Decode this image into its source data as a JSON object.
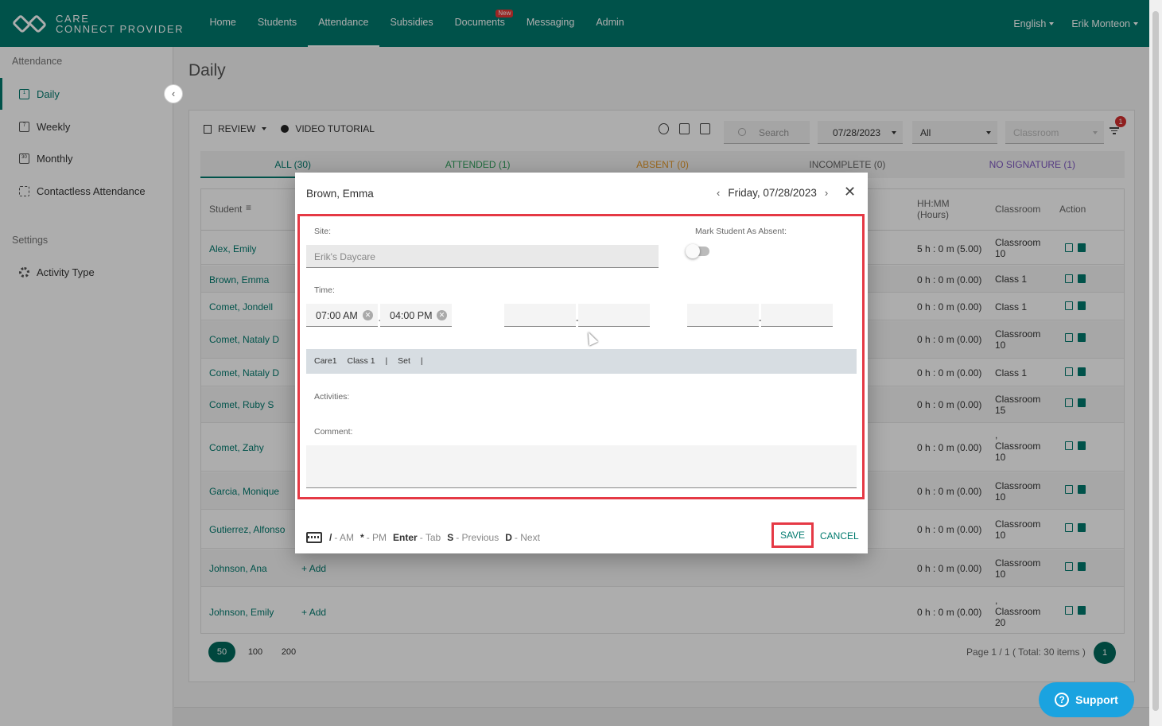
{
  "brand": {
    "line1": "CARE",
    "line2": "CONNECT PROVIDER"
  },
  "nav": {
    "items": [
      {
        "label": "Home"
      },
      {
        "label": "Students"
      },
      {
        "label": "Attendance"
      },
      {
        "label": "Subsidies"
      },
      {
        "label": "Documents"
      },
      {
        "label": "Messaging"
      },
      {
        "label": "Admin"
      }
    ],
    "new_badge": "New",
    "language": "English",
    "user": "Erik Monteon"
  },
  "sidebar": {
    "heading1": "Attendance",
    "items": [
      {
        "label": "Daily",
        "icon": "calendar-day-icon",
        "glyph": "1"
      },
      {
        "label": "Weekly",
        "icon": "calendar-week-icon",
        "glyph": "7"
      },
      {
        "label": "Monthly",
        "icon": "calendar-month-icon",
        "glyph": "30"
      },
      {
        "label": "Contactless Attendance",
        "icon": "grid-icon",
        "glyph": ""
      }
    ],
    "heading2": "Settings",
    "settings_item": {
      "label": "Activity Type",
      "icon": "gear-icon"
    },
    "collapse_glyph": "‹"
  },
  "page": {
    "title": "Daily"
  },
  "toolbar": {
    "review": "REVIEW",
    "video": "VIDEO TUTORIAL",
    "search_placeholder": "Search",
    "date": "07/28/2023",
    "filter_all": "All",
    "classroom_placeholder": "Classroom",
    "filter_count": "1"
  },
  "tabs": [
    {
      "label": "ALL (30)",
      "color": "#007a6e"
    },
    {
      "label": "ATTENDED (1)",
      "color": "#2e9e5b"
    },
    {
      "label": "ABSENT (0)",
      "color": "#e59a2b"
    },
    {
      "label": "INCOMPLETE (0)",
      "color": "#666666"
    },
    {
      "label": "NO SIGNATURE (1)",
      "color": "#7e57c2"
    }
  ],
  "table": {
    "headers": {
      "student": "Student",
      "hours_line1": "HH:MM",
      "hours_line2": "(Hours)",
      "classroom": "Classroom",
      "action": "Action"
    },
    "add_label": "Add",
    "rows": [
      {
        "name": "Alex, Emily",
        "hours": "5 h : 0 m (5.00)",
        "cls1": "Classroom",
        "cls2": "10",
        "cls3": ""
      },
      {
        "name": "Brown, Emma",
        "hours": "0 h : 0 m (0.00)",
        "cls1": "Class 1",
        "cls2": "",
        "cls3": ""
      },
      {
        "name": "Comet, Jondell",
        "hours": "0 h : 0 m (0.00)",
        "cls1": "Class 1",
        "cls2": "",
        "cls3": ""
      },
      {
        "name": "Comet, Nataly D",
        "hours": "0 h : 0 m (0.00)",
        "cls1": "Classroom",
        "cls2": "10",
        "cls3": ""
      },
      {
        "name": "Comet, Nataly D",
        "hours": "0 h : 0 m (0.00)",
        "cls1": "Class 1",
        "cls2": "",
        "cls3": ""
      },
      {
        "name": "Comet, Ruby S",
        "hours": "0 h : 0 m (0.00)",
        "cls1": "Classroom",
        "cls2": "15",
        "cls3": ""
      },
      {
        "name": "Comet, Zahy",
        "hours": "0 h : 0 m (0.00)",
        "cls1": ",",
        "cls2": "Classroom",
        "cls3": "10"
      },
      {
        "name": "Garcia, Monique",
        "hours": "0 h : 0 m (0.00)",
        "cls1": "Classroom",
        "cls2": "10",
        "cls3": ""
      },
      {
        "name": "Gutierrez, Alfonso",
        "hours": "0 h : 0 m (0.00)",
        "cls1": "Classroom",
        "cls2": "10",
        "cls3": ""
      },
      {
        "name": "Johnson, Ana",
        "hours": "0 h : 0 m (0.00)",
        "cls1": "Classroom",
        "cls2": "10",
        "cls3": ""
      },
      {
        "name": "Johnson, Emily",
        "hours": "0 h : 0 m (0.00)",
        "cls1": ",",
        "cls2": "Classroom",
        "cls3": "20"
      }
    ]
  },
  "pager": {
    "sizes": [
      "50",
      "100",
      "200"
    ],
    "summary": "Page 1 / 1 ( Total: 30 items )",
    "current": "1"
  },
  "modal": {
    "title": "Brown, Emma",
    "date": "Friday, 07/28/2023",
    "site_label": "Site:",
    "site_value": "Erik's Daycare",
    "absent_label": "Mark Student As Absent:",
    "absent_on": false,
    "time_label": "Time:",
    "time_in": "07:00 AM",
    "time_out": "04:00 PM",
    "care_bar": {
      "care": "Care1",
      "class": "Class 1",
      "sep": "|",
      "set": "Set"
    },
    "activities_label": "Activities:",
    "comment_label": "Comment:",
    "shortcuts": [
      {
        "key": "/",
        "desc": "- AM"
      },
      {
        "key": "*",
        "desc": "- PM"
      },
      {
        "key": "Enter",
        "desc": "- Tab"
      },
      {
        "key": "S",
        "desc": "- Previous"
      },
      {
        "key": "D",
        "desc": "- Next"
      }
    ],
    "save": "SAVE",
    "cancel": "CANCEL"
  },
  "support": {
    "label": "Support"
  }
}
